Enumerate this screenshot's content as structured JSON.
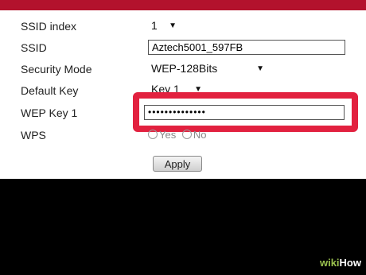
{
  "form": {
    "rows": [
      {
        "label": "SSID index",
        "value": "1"
      },
      {
        "label": "SSID",
        "value": "Aztech5001_597FB"
      },
      {
        "label": "Security Mode",
        "value": "WEP-128Bits"
      },
      {
        "label": "Default Key",
        "value": "Key 1"
      },
      {
        "label": "WEP Key 1",
        "value": "••••••••••••••"
      },
      {
        "label": "WPS",
        "value": ""
      }
    ],
    "wps_options": {
      "yes": "Yes",
      "no": "No"
    },
    "apply_label": "Apply"
  },
  "watermark": {
    "prefix": "wiki",
    "brand": "How"
  },
  "colors": {
    "highlight": "#e2213f",
    "topbar": "#b3122d"
  }
}
